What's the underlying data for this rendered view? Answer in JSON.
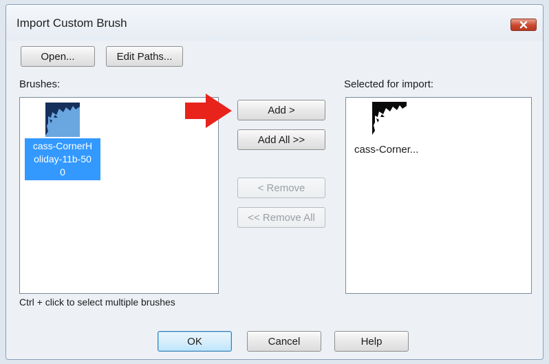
{
  "dialog": {
    "title": "Import Custom Brush",
    "close_icon": "close-x-icon"
  },
  "toolbar": {
    "open_label": "Open...",
    "edit_paths_label": "Edit Paths..."
  },
  "brushes": {
    "label": "Brushes:",
    "items": [
      {
        "name": "cass-CornerHoliday-11b-500",
        "name_lines": [
          "cass-CornerH",
          "oliday-11b-50",
          "0"
        ],
        "selected": true
      }
    ],
    "hint": "Ctrl + click to select multiple brushes"
  },
  "selected": {
    "label": "Selected for import:",
    "items": [
      {
        "name": "cass-Corner..."
      }
    ]
  },
  "actions": {
    "add_label": "Add >",
    "add_all_label": "Add All >>",
    "remove_label": "< Remove",
    "remove_all_label": "<< Remove All"
  },
  "footer": {
    "ok_label": "OK",
    "cancel_label": "Cancel",
    "help_label": "Help"
  },
  "colors": {
    "selection": "#3399ff",
    "arrow": "#e8231b",
    "close_button": "#c9472d"
  }
}
